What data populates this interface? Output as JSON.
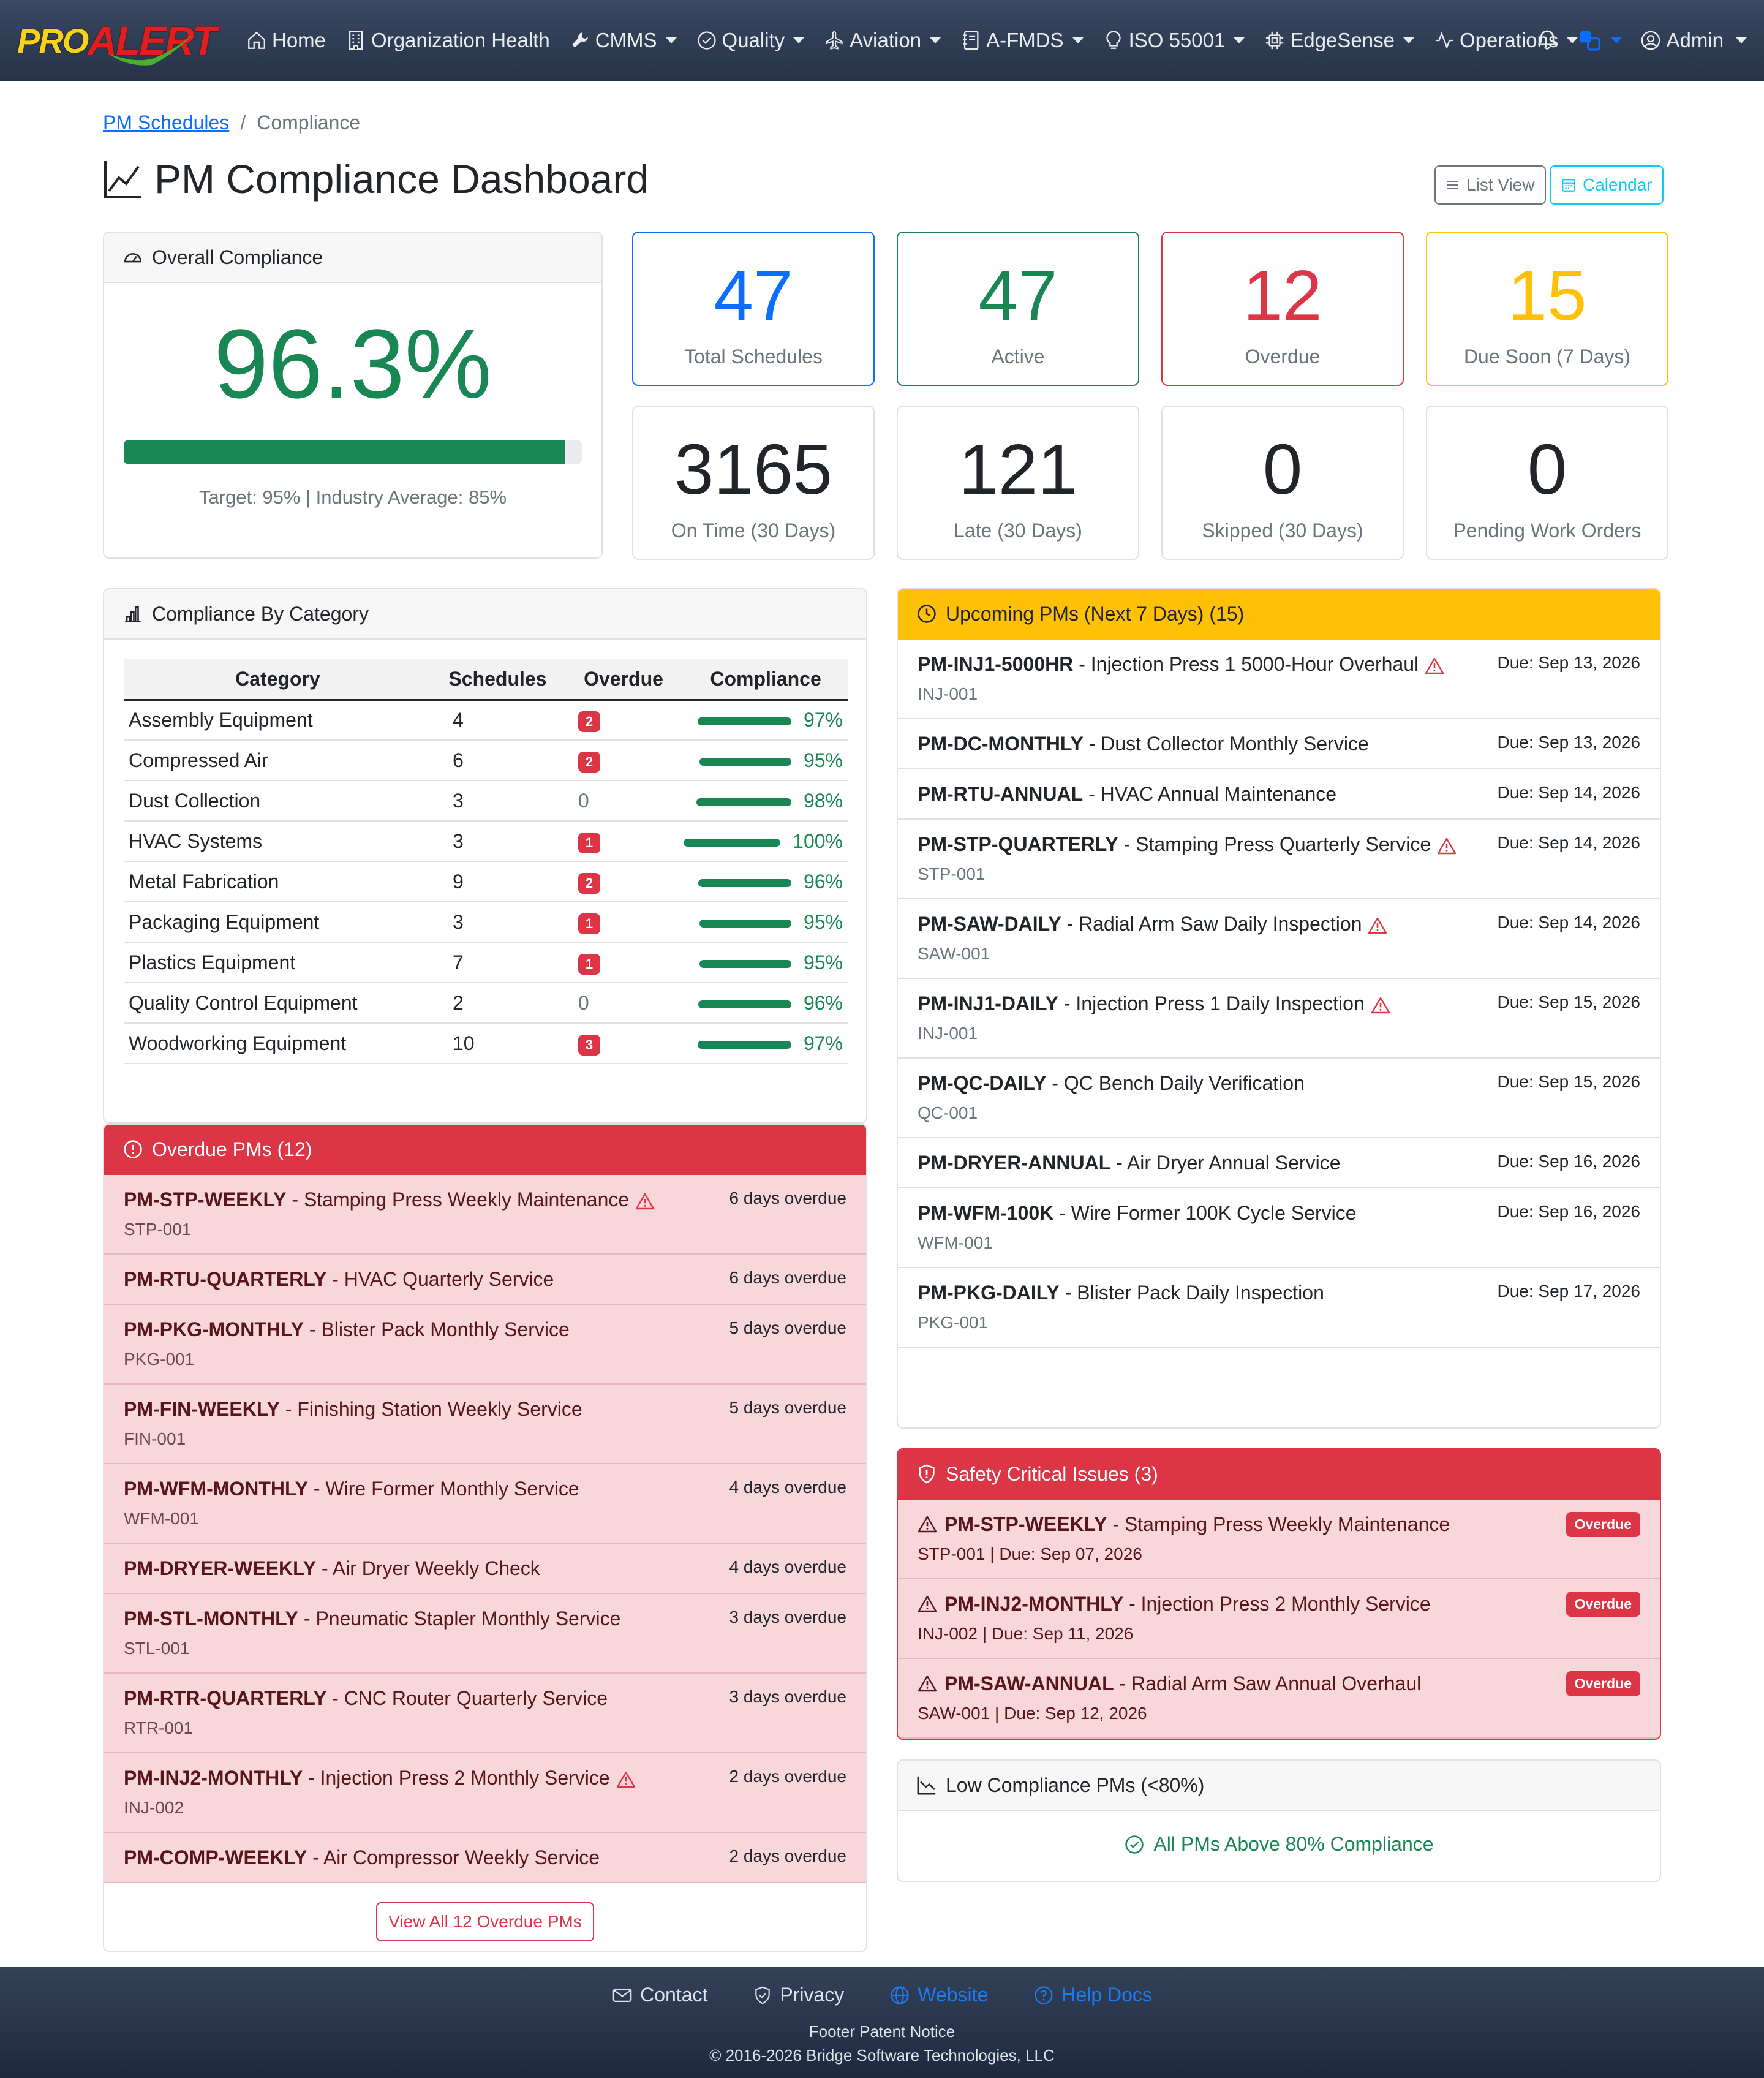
{
  "app": {
    "logo_pro": "PRO",
    "logo_alert": "ALERT"
  },
  "nav": [
    {
      "label": "Home",
      "icon": "home-icon",
      "caret": false
    },
    {
      "label": "Organization Health",
      "icon": "building-icon",
      "caret": false
    },
    {
      "label": "CMMS",
      "icon": "wrench-icon",
      "caret": true
    },
    {
      "label": "Quality",
      "icon": "check-circle-icon",
      "caret": true
    },
    {
      "label": "Aviation",
      "icon": "airplane-icon",
      "caret": true
    },
    {
      "label": "A-FMDS",
      "icon": "journal-icon",
      "caret": true
    },
    {
      "label": "ISO 55001",
      "icon": "lightbulb-icon",
      "caret": true
    },
    {
      "label": "EdgeSense",
      "icon": "cpu-icon",
      "caret": true
    },
    {
      "label": "Operations",
      "icon": "activity-icon",
      "caret": true
    }
  ],
  "user": {
    "name": "Admin"
  },
  "breadcrumb": {
    "link": "PM Schedules",
    "current": "Compliance"
  },
  "page": {
    "title": "PM Compliance Dashboard",
    "list_view": "List View",
    "calendar": "Calendar"
  },
  "overall": {
    "header": "Overall Compliance",
    "value": "96.3%",
    "progress": 0.963,
    "note": "Target: 95% | Industry Average: 85%"
  },
  "stats": [
    {
      "value": "47",
      "label": "Total Schedules",
      "color": "#0d6efd"
    },
    {
      "value": "47",
      "label": "Active",
      "color": "#198754"
    },
    {
      "value": "12",
      "label": "Overdue",
      "color": "#dc3545"
    },
    {
      "value": "15",
      "label": "Due Soon (7 Days)",
      "color": "#ffc107"
    },
    {
      "value": "3165",
      "label": "On Time (30 Days)",
      "color": "#212529"
    },
    {
      "value": "121",
      "label": "Late (30 Days)",
      "color": "#212529"
    },
    {
      "value": "0",
      "label": "Skipped (30 Days)",
      "color": "#212529"
    },
    {
      "value": "0",
      "label": "Pending Work Orders",
      "color": "#212529"
    }
  ],
  "category": {
    "header": "Compliance By Category",
    "columns": [
      "Category",
      "Schedules",
      "Overdue",
      "Compliance"
    ],
    "rows": [
      {
        "name": "Assembly Equipment",
        "schedules": "4",
        "overdue": "2",
        "compliance": "97%",
        "pct": 0.97
      },
      {
        "name": "Compressed Air",
        "schedules": "6",
        "overdue": "2",
        "compliance": "95%",
        "pct": 0.95
      },
      {
        "name": "Dust Collection",
        "schedules": "3",
        "overdue": "0",
        "compliance": "98%",
        "pct": 0.98
      },
      {
        "name": "HVAC Systems",
        "schedules": "3",
        "overdue": "1",
        "compliance": "100%",
        "pct": 1.0
      },
      {
        "name": "Metal Fabrication",
        "schedules": "9",
        "overdue": "2",
        "compliance": "96%",
        "pct": 0.96
      },
      {
        "name": "Packaging Equipment",
        "schedules": "3",
        "overdue": "1",
        "compliance": "95%",
        "pct": 0.95
      },
      {
        "name": "Plastics Equipment",
        "schedules": "7",
        "overdue": "1",
        "compliance": "95%",
        "pct": 0.95
      },
      {
        "name": "Quality Control Equipment",
        "schedules": "2",
        "overdue": "0",
        "compliance": "96%",
        "pct": 0.96
      },
      {
        "name": "Woodworking Equipment",
        "schedules": "10",
        "overdue": "3",
        "compliance": "97%",
        "pct": 0.97
      }
    ]
  },
  "overdue": {
    "header": "Overdue PMs (12)",
    "items": [
      {
        "code": "PM-STP-WEEKLY",
        "name": "Stamping Press Weekly Maintenance",
        "asset": "STP-001",
        "status": "6 days overdue",
        "warn": true
      },
      {
        "code": "PM-RTU-QUARTERLY",
        "name": "HVAC Quarterly Service",
        "asset": "",
        "status": "6 days overdue",
        "warn": false
      },
      {
        "code": "PM-PKG-MONTHLY",
        "name": "Blister Pack Monthly Service",
        "asset": "PKG-001",
        "status": "5 days overdue",
        "warn": false
      },
      {
        "code": "PM-FIN-WEEKLY",
        "name": "Finishing Station Weekly Service",
        "asset": "FIN-001",
        "status": "5 days overdue",
        "warn": false
      },
      {
        "code": "PM-WFM-MONTHLY",
        "name": "Wire Former Monthly Service",
        "asset": "WFM-001",
        "status": "4 days overdue",
        "warn": false
      },
      {
        "code": "PM-DRYER-WEEKLY",
        "name": "Air Dryer Weekly Check",
        "asset": "",
        "status": "4 days overdue",
        "warn": false
      },
      {
        "code": "PM-STL-MONTHLY",
        "name": "Pneumatic Stapler Monthly Service",
        "asset": "STL-001",
        "status": "3 days overdue",
        "warn": false
      },
      {
        "code": "PM-RTR-QUARTERLY",
        "name": "CNC Router Quarterly Service",
        "asset": "RTR-001",
        "status": "3 days overdue",
        "warn": false
      },
      {
        "code": "PM-INJ2-MONTHLY",
        "name": "Injection Press 2 Monthly Service",
        "asset": "INJ-002",
        "status": "2 days overdue",
        "warn": true
      },
      {
        "code": "PM-COMP-WEEKLY",
        "name": "Air Compressor Weekly Service",
        "asset": "",
        "status": "2 days overdue",
        "warn": false
      }
    ],
    "view_all": "View All 12 Overdue PMs"
  },
  "upcoming": {
    "header": "Upcoming PMs (Next 7 Days) (15)",
    "items": [
      {
        "code": "PM-INJ1-5000HR",
        "name": "Injection Press 1 5000-Hour Overhaul",
        "asset": "INJ-001",
        "due": "Due: Sep 13, 2026",
        "warn": true
      },
      {
        "code": "PM-DC-MONTHLY",
        "name": "Dust Collector Monthly Service",
        "asset": "",
        "due": "Due: Sep 13, 2026",
        "warn": false
      },
      {
        "code": "PM-RTU-ANNUAL",
        "name": "HVAC Annual Maintenance",
        "asset": "",
        "due": "Due: Sep 14, 2026",
        "warn": false
      },
      {
        "code": "PM-STP-QUARTERLY",
        "name": "Stamping Press Quarterly Service",
        "asset": "STP-001",
        "due": "Due: Sep 14, 2026",
        "warn": true
      },
      {
        "code": "PM-SAW-DAILY",
        "name": "Radial Arm Saw Daily Inspection",
        "asset": "SAW-001",
        "due": "Due: Sep 14, 2026",
        "warn": true
      },
      {
        "code": "PM-INJ1-DAILY",
        "name": "Injection Press 1 Daily Inspection",
        "asset": "INJ-001",
        "due": "Due: Sep 15, 2026",
        "warn": true
      },
      {
        "code": "PM-QC-DAILY",
        "name": "QC Bench Daily Verification",
        "asset": "QC-001",
        "due": "Due: Sep 15, 2026",
        "warn": false
      },
      {
        "code": "PM-DRYER-ANNUAL",
        "name": "Air Dryer Annual Service",
        "asset": "",
        "due": "Due: Sep 16, 2026",
        "warn": false
      },
      {
        "code": "PM-WFM-100K",
        "name": "Wire Former 100K Cycle Service",
        "asset": "WFM-001",
        "due": "Due: Sep 16, 2026",
        "warn": false
      },
      {
        "code": "PM-PKG-DAILY",
        "name": "Blister Pack Daily Inspection",
        "asset": "PKG-001",
        "due": "Due: Sep 17, 2026",
        "warn": false
      }
    ]
  },
  "safety": {
    "header": "Safety Critical Issues (3)",
    "items": [
      {
        "code": "PM-STP-WEEKLY",
        "name": "Stamping Press Weekly Maintenance",
        "sub": "STP-001 | Due: Sep 07, 2026",
        "badge": "Overdue"
      },
      {
        "code": "PM-INJ2-MONTHLY",
        "name": "Injection Press 2 Monthly Service",
        "sub": "INJ-002 | Due: Sep 11, 2026",
        "badge": "Overdue"
      },
      {
        "code": "PM-SAW-ANNUAL",
        "name": "Radial Arm Saw Annual Overhaul",
        "sub": "SAW-001 | Due: Sep 12, 2026",
        "badge": "Overdue"
      }
    ]
  },
  "low": {
    "header": "Low Compliance PMs (<80%)",
    "message": "All PMs Above 80% Compliance"
  },
  "footer": {
    "contact": "Contact",
    "privacy": "Privacy",
    "website": "Website",
    "help": "Help Docs",
    "patent": "Footer Patent Notice",
    "copyright": "© 2016-2026 Bridge Software Technologies, LLC"
  }
}
